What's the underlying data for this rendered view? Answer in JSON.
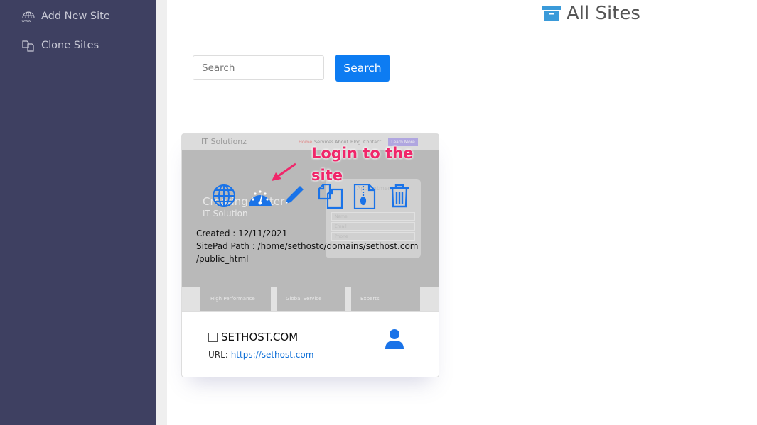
{
  "sidebar": {
    "items": [
      {
        "label": "Add New Site",
        "icon": "www-globe-icon"
      },
      {
        "label": "Clone Sites",
        "icon": "clone-icon"
      }
    ]
  },
  "header": {
    "title": "All Sites",
    "icon": "archive-icon",
    "accent": "#3a9ad9"
  },
  "search": {
    "placeholder": "Search",
    "button_label": "Search",
    "button_color": "#0d7cf2"
  },
  "site": {
    "preview": {
      "brand": "IT Solutionz",
      "nav": [
        "Home",
        "Services",
        "About",
        "Blog",
        "Contact"
      ],
      "cta": "Learn More",
      "headline": "Creating Better",
      "subheadline": "IT Solution",
      "form_title": "Appointment",
      "form_fields": [
        "Name",
        "Email",
        "Phone"
      ],
      "features": [
        "High Performance",
        "Global Service",
        "Experts"
      ]
    },
    "actions": [
      "visit-site-globe-icon",
      "login-dashboard-icon",
      "edit-pencil-icon",
      "clone-icon",
      "backup-zip-icon",
      "delete-trash-icon"
    ],
    "created_label": "Created : 12/11/2021",
    "path_label": "SitePad Path : /home/sethostc/domains/sethost.com",
    "path_label_2": "/public_html",
    "name": "SETHOST.COM",
    "url_label": "URL:",
    "url": "https://sethost.com",
    "owner_icon": "user-icon"
  },
  "annotation": {
    "line1": "Login to the",
    "line2": "site",
    "color": "#f0266a"
  }
}
